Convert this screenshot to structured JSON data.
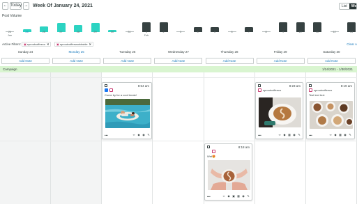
{
  "header": {
    "prev_label": "←",
    "today_label": "Today",
    "next_label": "→",
    "title": "Week Of January 24, 2021",
    "view_list": "List",
    "view_week": "Week"
  },
  "post_volume": {
    "label": "Post Volume",
    "days": [
      {
        "d": "24",
        "sub": "Jan",
        "v": 0,
        "kind": "zero",
        "hl": false
      },
      {
        "d": "25",
        "sub": "",
        "v": 3,
        "kind": "now",
        "hl": true
      },
      {
        "d": "26",
        "sub": "",
        "v": 6,
        "kind": "now",
        "hl": false
      },
      {
        "d": "27",
        "sub": "",
        "v": 9,
        "kind": "now",
        "hl": false
      },
      {
        "d": "28",
        "sub": "",
        "v": 7,
        "kind": "now",
        "hl": false
      },
      {
        "d": "29",
        "sub": "",
        "v": 9,
        "kind": "now",
        "hl": false
      },
      {
        "d": "30",
        "sub": "",
        "v": 2,
        "kind": "now",
        "hl": false
      },
      {
        "d": "31",
        "sub": "",
        "v": 0,
        "kind": "zero",
        "hl": false
      },
      {
        "d": "1",
        "sub": "Feb",
        "v": 10,
        "kind": "fut",
        "hl": false
      },
      {
        "d": "2",
        "sub": "",
        "v": 10,
        "kind": "fut",
        "hl": false
      },
      {
        "d": "3",
        "sub": "",
        "v": 0,
        "kind": "zero",
        "hl": false
      },
      {
        "d": "4",
        "sub": "",
        "v": 5,
        "kind": "fut",
        "hl": false
      },
      {
        "d": "5",
        "sub": "",
        "v": 5,
        "kind": "fut",
        "hl": false
      },
      {
        "d": "6",
        "sub": "",
        "v": 0,
        "kind": "zero",
        "hl": false
      },
      {
        "d": "7",
        "sub": "",
        "v": 5,
        "kind": "fut",
        "hl": false
      },
      {
        "d": "8",
        "sub": "",
        "v": 0,
        "kind": "zero",
        "hl": false
      },
      {
        "d": "9",
        "sub": "",
        "v": 10,
        "kind": "fut",
        "hl": false
      },
      {
        "d": "10",
        "sub": "",
        "v": 10,
        "kind": "fut",
        "hl": false
      },
      {
        "d": "11",
        "sub": "",
        "v": 10,
        "kind": "fut",
        "hl": false
      },
      {
        "d": "12",
        "sub": "",
        "v": 0,
        "kind": "zero",
        "hl": false
      },
      {
        "d": "13",
        "sub": "",
        "v": 10,
        "kind": "fut",
        "hl": false
      },
      {
        "d": "14",
        "sub": "",
        "v": 10,
        "kind": "fut",
        "hl": false
      }
    ]
  },
  "filters": {
    "label": "Active Filters:",
    "chips": [
      "sproutcoffeeco",
      "sproutcoffeeworldwide"
    ],
    "clear_all": "Clear A"
  },
  "days": [
    {
      "name": "Sunday 24",
      "hl": false,
      "past": true
    },
    {
      "name": "Monday 25",
      "hl": true,
      "past": true
    },
    {
      "name": "Tuesday 26",
      "hl": false,
      "past": false
    },
    {
      "name": "Wednesday 27",
      "hl": false,
      "past": false
    },
    {
      "name": "Thursday 28",
      "hl": false,
      "past": false
    },
    {
      "name": "Friday 29",
      "hl": false,
      "past": false
    },
    {
      "name": "Saturday 30",
      "hl": false,
      "past": false
    }
  ],
  "add_note_label": "Add Note",
  "campaign": {
    "name": "Campaign",
    "range": "1/24/2021 - 1/30/2021"
  },
  "posts": {
    "tuesday": {
      "time": "8:54 am",
      "caption": "Come by for a cool break!"
    },
    "thursday": {
      "time": "8:18 am",
      "caption": "Wet😍"
    },
    "friday": {
      "time": "8:23 am",
      "handle": "sproutcoffeeco"
    },
    "saturday": {
      "time": "8:19 am",
      "handle": "sproutcoffeeco",
      "caption": "Test text text"
    }
  },
  "colors": {
    "accent": "#2cd3c2",
    "future_bar": "#364141",
    "link": "#1a7bbd",
    "campaign": "#d9f5d0"
  }
}
